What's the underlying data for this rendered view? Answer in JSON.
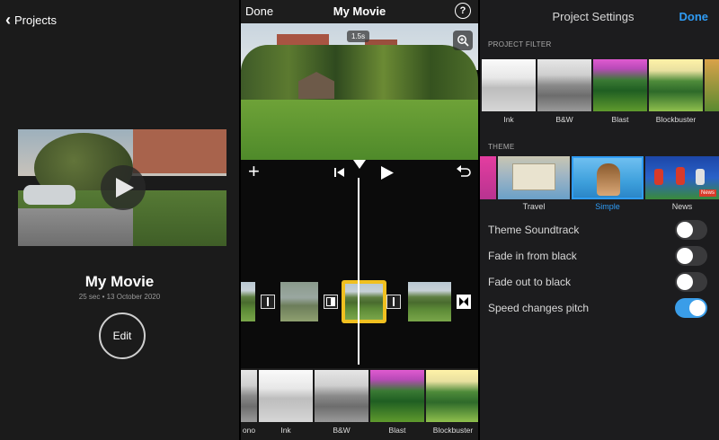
{
  "panel1": {
    "back_label": "Projects",
    "project_title": "My Movie",
    "project_meta": "25 sec • 13 October 2020",
    "edit_label": "Edit"
  },
  "panel2": {
    "done_label": "Done",
    "title": "My Movie",
    "help_label": "?",
    "duration_badge": "1.5s",
    "filters": [
      "ono",
      "Ink",
      "B&W",
      "Blast",
      "Blockbuster"
    ]
  },
  "panel3": {
    "title": "Project Settings",
    "done_label": "Done",
    "project_filter_label": "PROJECT FILTER",
    "filters": [
      "Ink",
      "B&W",
      "Blast",
      "Blockbuster"
    ],
    "theme_label": "THEME",
    "themes": [
      "Travel",
      "Simple",
      "News"
    ],
    "selected_theme": "Simple",
    "news_badge": "News",
    "settings": [
      {
        "label": "Theme Soundtrack",
        "on": false
      },
      {
        "label": "Fade in from black",
        "on": false
      },
      {
        "label": "Fade out to black",
        "on": false
      },
      {
        "label": "Speed changes pitch",
        "on": true
      }
    ]
  },
  "colors": {
    "accent_blue": "#2f9cf5",
    "selection_yellow": "#f0c020",
    "toggle_on": "#3a9de8"
  }
}
